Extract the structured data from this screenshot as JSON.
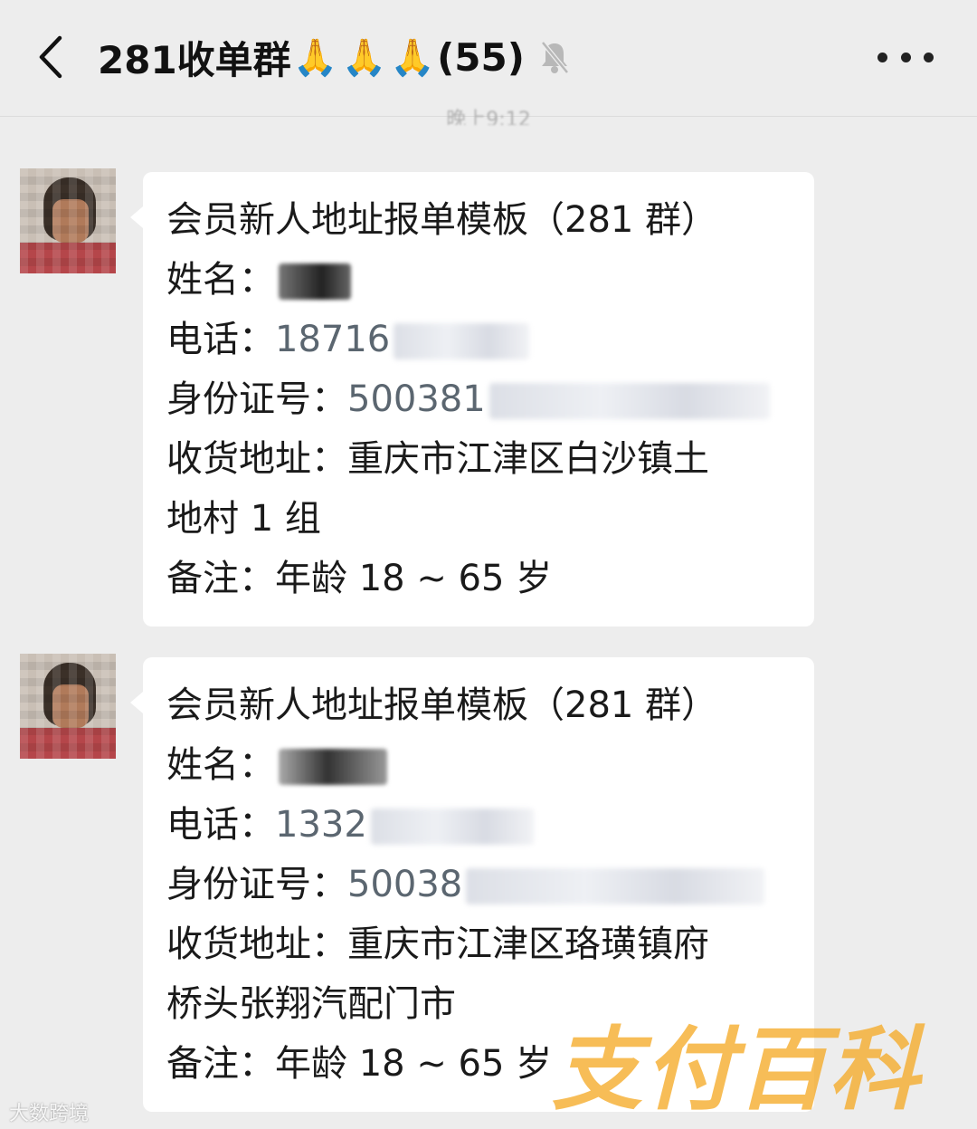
{
  "header": {
    "title": "281收单群",
    "emojis": [
      "🙏",
      "🙏",
      "🙏"
    ],
    "member_count": "(55)",
    "icons": {
      "back": "chevron-left-icon",
      "mute": "bell-muted-icon",
      "more": "more-dots-icon"
    }
  },
  "timestamp": "晚上9:12",
  "messages": [
    {
      "title": "会员新人地址报单模板（281 群）",
      "name_label": "姓名：",
      "name_value": "",
      "phone_label": "电话：",
      "phone_value": "18716",
      "id_label": "身份证号：",
      "id_value": "500381",
      "address_label": "收货地址：",
      "address_line1": "重庆市江津区白沙镇土",
      "address_line2": "地村 1 组",
      "note_label": "备注：",
      "note_value": "年龄 18 ~ 65 岁"
    },
    {
      "title": "会员新人地址报单模板（281 群）",
      "name_label": "姓名：",
      "name_value": "",
      "phone_label": "电话：",
      "phone_value": "1332",
      "id_label": "身份证号：",
      "id_value": "50038",
      "address_label": "收货地址：",
      "address_line1": "重庆市江津区珞璜镇府",
      "address_line2": "桥头张翔汽配门市",
      "note_label": "备注：",
      "note_value": "年龄 18 ~ 65 岁"
    }
  ],
  "watermarks": {
    "logo": "支付百科",
    "small": "大数跨境"
  }
}
